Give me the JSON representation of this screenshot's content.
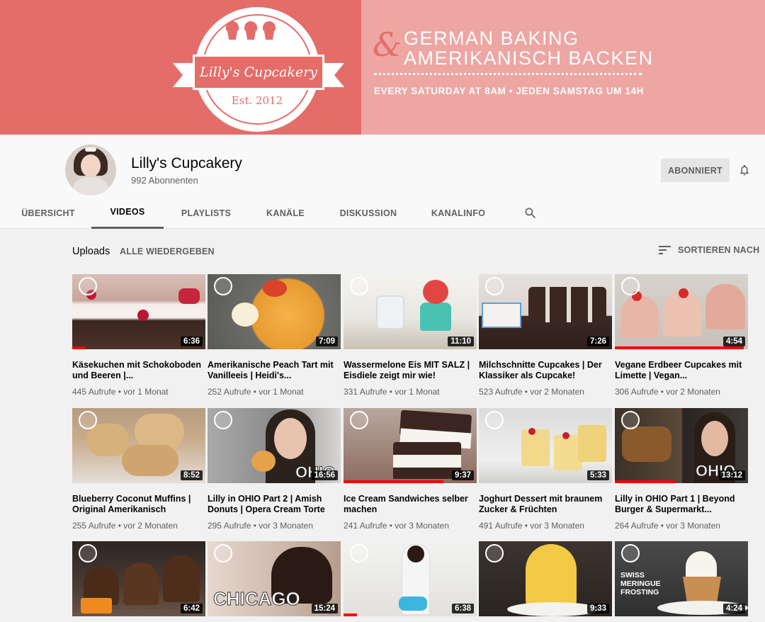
{
  "banner": {
    "logo_text": "Lilly's Cupcakery",
    "logo_est": "Est. 2012",
    "ampersand": "&",
    "tagline_line1": "GERMAN BAKING",
    "tagline_line2": "AMERIKANISCH BACKEN",
    "schedule": "EVERY SATURDAY AT 8AM • JEDEN SAMSTAG UM 14H",
    "colors": {
      "left": "#e46d6a",
      "right": "#eea6a3"
    }
  },
  "channel": {
    "name": "Lilly's Cupcakery",
    "subscribers": "992 Abonnenten",
    "subscribe_label": "ABONNIERT"
  },
  "tabs": [
    {
      "label": "ÜBERSICHT",
      "active": false
    },
    {
      "label": "VIDEOS",
      "active": true
    },
    {
      "label": "PLAYLISTS",
      "active": false
    },
    {
      "label": "KANÄLE",
      "active": false
    },
    {
      "label": "DISKUSSION",
      "active": false
    },
    {
      "label": "KANALINFO",
      "active": false
    }
  ],
  "uploads": {
    "title": "Uploads",
    "play_all": "ALLE WIEDERGEBEN",
    "sort_label": "SORTIEREN NACH"
  },
  "videos": [
    {
      "title": "Käsekuchen mit Schokoboden und Beeren |...",
      "views": "445 Aufrufe",
      "age": "vor 1 Monat",
      "duration": "6:36",
      "watched_fraction": 0.1
    },
    {
      "title": "Amerikanische Peach Tart mit Vanilleeis | Heidi's...",
      "views": "252 Aufrufe",
      "age": "vor 1 Monat",
      "duration": "7:09",
      "watched_fraction": 0
    },
    {
      "title": "Wassermelone Eis MIT SALZ | Eisdiele zeigt mir wie!",
      "views": "331 Aufrufe",
      "age": "vor 1 Monat",
      "duration": "11:10",
      "watched_fraction": 0
    },
    {
      "title": "Milchschnitte Cupcakes | Der Klassiker als Cupcake!",
      "views": "523 Aufrufe",
      "age": "vor 2 Monaten",
      "duration": "7:26",
      "watched_fraction": 0
    },
    {
      "title": "Vegane Erdbeer Cupcakes mit Limette | Vegan...",
      "views": "306 Aufrufe",
      "age": "vor 2 Monaten",
      "duration": "4:54",
      "watched_fraction": 0.97
    },
    {
      "title": "Blueberry Coconut Muffins | Original Amerikanisch",
      "views": "255 Aufrufe",
      "age": "vor 2 Monaten",
      "duration": "8:52",
      "watched_fraction": 0
    },
    {
      "title": "Lilly in OHIO Part 2 | Amish Donuts | Opera Cream Torte",
      "views": "295 Aufrufe",
      "age": "vor 3 Monaten",
      "duration": "16:56",
      "watched_fraction": 0,
      "overlay": "OHIO"
    },
    {
      "title": "Ice Cream Sandwiches selber machen",
      "views": "241 Aufrufe",
      "age": "vor 3 Monaten",
      "duration": "9:37",
      "watched_fraction": 0.75
    },
    {
      "title": "Joghurt Dessert mit braunem Zucker & Früchten",
      "views": "491 Aufrufe",
      "age": "vor 3 Monaten",
      "duration": "5:33",
      "watched_fraction": 0
    },
    {
      "title": "Lilly in OHIO Part 1 | Beyond Burger & Supermarkt...",
      "views": "264 Aufrufe",
      "age": "vor 3 Monaten",
      "duration": "13:12",
      "watched_fraction": 0.45,
      "overlay": "OHIO"
    },
    {
      "title": "",
      "views": "",
      "age": "",
      "duration": "6:42",
      "watched_fraction": 0
    },
    {
      "title": "",
      "views": "",
      "age": "",
      "duration": "15:24",
      "watched_fraction": 0,
      "overlay": "CHICAGO"
    },
    {
      "title": "",
      "views": "",
      "age": "",
      "duration": "6:38",
      "watched_fraction": 0.1
    },
    {
      "title": "",
      "views": "",
      "age": "",
      "duration": "9:33",
      "watched_fraction": 0
    },
    {
      "title": "",
      "views": "",
      "age": "",
      "duration": "4:24",
      "watched_fraction": 0,
      "overlay": "SWISS MERINGUE FROSTING"
    }
  ]
}
